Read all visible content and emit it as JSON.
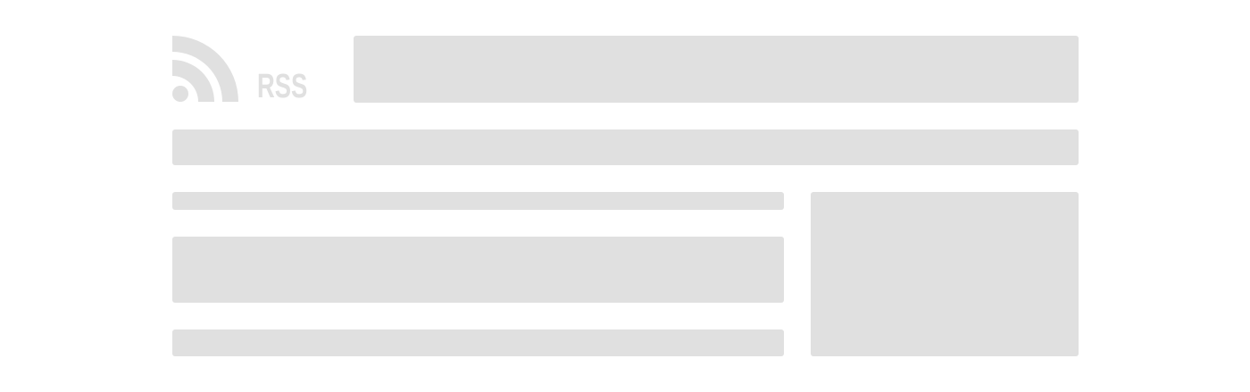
{
  "logo": {
    "icon": "rss-icon",
    "text": "RSS"
  },
  "colors": {
    "background": "#ffffff",
    "placeholder": "#e0e0e0"
  }
}
